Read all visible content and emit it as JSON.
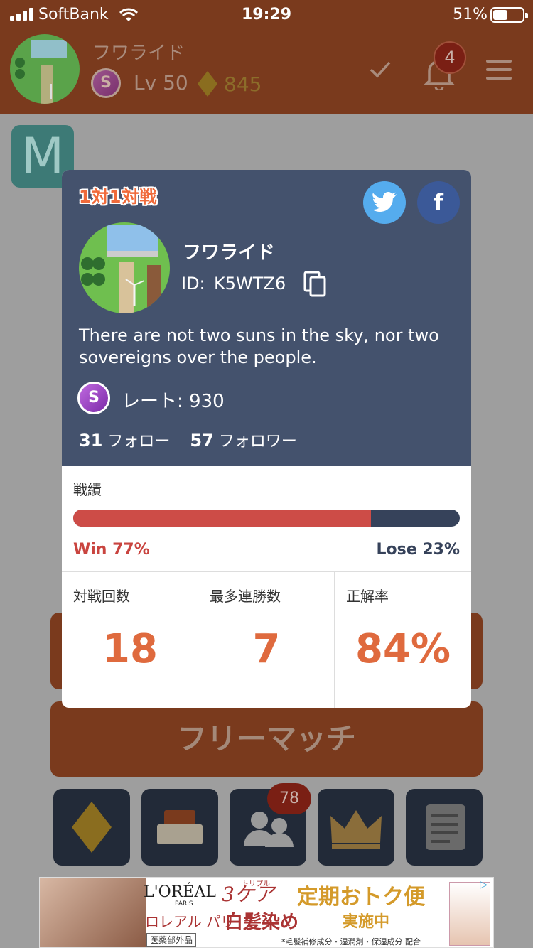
{
  "status_bar": {
    "carrier": "SoftBank",
    "time": "19:29",
    "battery": "51%"
  },
  "header": {
    "user_name": "フワライド",
    "rank": "S",
    "level": "Lv 50",
    "gems": "845",
    "notification_count": "4"
  },
  "background": {
    "free_match_label": "フリーマッチ",
    "friends_badge": "78"
  },
  "modal": {
    "mode_title": "1対1対戦",
    "name": "フワライド",
    "id_label": "ID:",
    "id": "K5WTZ6",
    "bio": "There are not two suns in the sky, nor two sovereigns over the people.",
    "rank": "S",
    "rate": "レート: 930",
    "following_count": "31",
    "following_label": "フォロー",
    "followers_count": "57",
    "followers_label": "フォロワー",
    "record_title": "戦績",
    "win_rate": 0.77,
    "win_label": "Win 77%",
    "lose_label": "Lose 23%",
    "stats": [
      {
        "label": "対戦回数",
        "value": "18"
      },
      {
        "label": "最多連勝数",
        "value": "7"
      },
      {
        "label": "正解率",
        "value": "84%"
      }
    ]
  },
  "ad": {
    "brand": "L'ORÉAL",
    "brand_sub": "PARIS",
    "care": "3ケア",
    "care_small": "トリプル",
    "campaign": "定期おトク便",
    "jp_brand": "ロレアル パリ",
    "product": "白髪染め",
    "ongoing": "実施中",
    "tag": "医薬部外品",
    "fine_print": "*毛髪補修成分・湿潤剤・保湿成分 配合"
  }
}
